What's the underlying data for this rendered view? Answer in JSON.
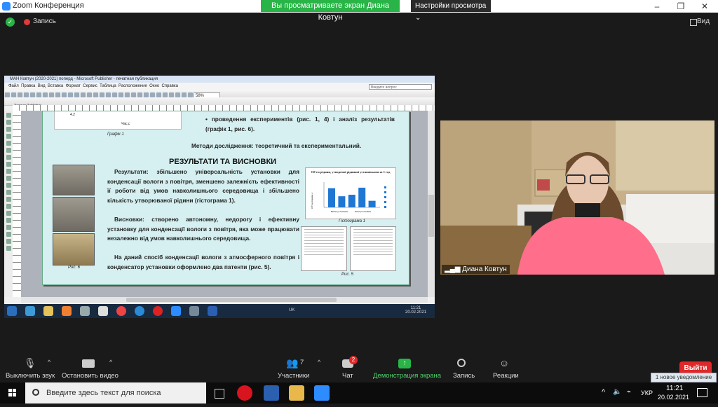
{
  "window": {
    "title": "Zoom Конференция",
    "share_banner": "Вы просматриваете экран Диана Ковтун",
    "view_settings": "Настройки просмотра",
    "recording_label": "Запись",
    "view_label": "Вид"
  },
  "shared_screen": {
    "app_title": "МАН Ковтун (2020-2021) поперд - Microsoft Publisher - печатная публикация",
    "menu": [
      "Файл",
      "Правка",
      "Вид",
      "Вставка",
      "Формат",
      "Сервис",
      "Таблица",
      "Расположение",
      "Окно",
      "Справка"
    ],
    "help_placeholder": "Введите вопрос",
    "zoom_level": "58%",
    "fonts_toolbar_label": "Задачи Publisher",
    "page": {
      "bullet_text": "проведення експериментів (рис. 1, 4) і аналіз результатів (графік 1, рис. 6).",
      "methods": "Методи дослідження: теоретичний та експериментальний.",
      "heading": "РЕЗУЛЬТАТИ ТА ВИСНОВКИ",
      "results": "Результати: збільшено універсальність установки для конденсації вологи з повітря, зменшено залежність ефективності її роботи від умов навколишнього середовища і збільшено кількість утворюваної рідини (гістограма 1).",
      "conclusions": "Висновки: створено автономну, недорогу і ефективну установку для конденсації вологи з повітря, яка може працювати незалежно від умов навколишнього середовища.",
      "patents": "На даний спосіб конденсації вологи з атмосферного повітря і конденсатор установки оформлено два патенти (рис. 5).",
      "graph_caption": "Графік 1",
      "graph_axis_label": "Час,с",
      "graph_value": "4.2",
      "fig6_caption": "Рис. 6",
      "hist_caption": "Гістограма 1",
      "fig5_caption": "Рис. 5",
      "chart_title": "Об'єм рідини, утвореної рідинної установками за 1 год",
      "chart_ylabel": "Об'єм рідини, л",
      "chart_xlabel_1": "Наша установка",
      "chart_xlabel_2": "Інші установки"
    },
    "clock_time": "11:21",
    "clock_date": "20.02.2021",
    "lang": "UK"
  },
  "chart_data": {
    "type": "bar",
    "title": "Об'єм рідини, утвореної рідинної установками за 1 год",
    "ylabel": "Об'єм рідини, л",
    "categories": [
      "Наша установка",
      "Інші установки"
    ],
    "values": [
      0.38,
      0.22,
      0.25,
      0.39,
      0.13
    ],
    "ylim": [
      0,
      0.5
    ],
    "series_color": "#1f77d4"
  },
  "participant": {
    "name": "Диана Ковтун"
  },
  "controls": {
    "mute": "Выключить звук",
    "stop_video": "Остановить видео",
    "participants": "Участники",
    "participants_count": "7",
    "chat": "Чат",
    "chat_badge": "2",
    "share": "Демонстрация экрана",
    "record": "Запись",
    "reactions": "Реакции",
    "exit": "Выйти",
    "notification": "1 новое уведомление"
  },
  "taskbar": {
    "search_placeholder": "Введите здесь текст для поиска",
    "lang": "УКР",
    "time": "11:21",
    "date": "20.02.2021"
  },
  "colors": {
    "zoom_green": "#28b446",
    "zoom_red": "#e02828",
    "zoom_blue": "#2d8cff",
    "page_bg": "#d6f0f1"
  }
}
